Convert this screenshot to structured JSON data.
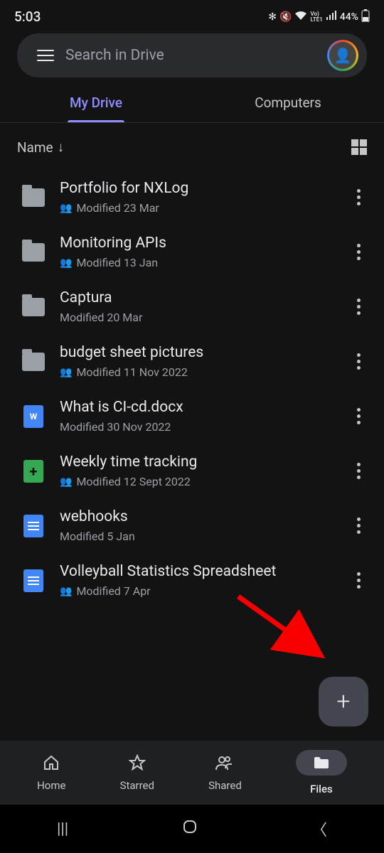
{
  "status": {
    "time": "5:03",
    "battery": "44%",
    "lte": "LTE1"
  },
  "search": {
    "placeholder": "Search in Drive"
  },
  "tabs": [
    {
      "label": "My Drive",
      "active": true
    },
    {
      "label": "Computers",
      "active": false
    }
  ],
  "sort": {
    "label": "Name"
  },
  "files": [
    {
      "type": "folder",
      "title": "Portfolio for NXLog",
      "shared": true,
      "modified": "Modified 23 Mar"
    },
    {
      "type": "folder",
      "title": "Monitoring APIs",
      "shared": true,
      "modified": "Modified 13 Jan"
    },
    {
      "type": "folder",
      "title": "Captura",
      "shared": false,
      "modified": "Modified 20 Mar"
    },
    {
      "type": "folder",
      "title": "budget sheet pictures",
      "shared": true,
      "modified": "Modified 11 Nov 2022"
    },
    {
      "type": "word",
      "title": "What is CI-cd.docx",
      "shared": false,
      "modified": "Modified 30 Nov 2022"
    },
    {
      "type": "sheets",
      "title": "Weekly time tracking",
      "shared": true,
      "modified": "Modified 12 Sept 2022"
    },
    {
      "type": "docs",
      "title": "webhooks",
      "shared": false,
      "modified": "Modified 5 Jan"
    },
    {
      "type": "docs",
      "title": "Volleyball Statistics Spreadsheet",
      "shared": true,
      "modified": "Modified 7 Apr"
    }
  ],
  "fab": {
    "label": "+"
  },
  "bottomNav": [
    {
      "label": "Home"
    },
    {
      "label": "Starred"
    },
    {
      "label": "Shared"
    },
    {
      "label": "Files"
    }
  ]
}
